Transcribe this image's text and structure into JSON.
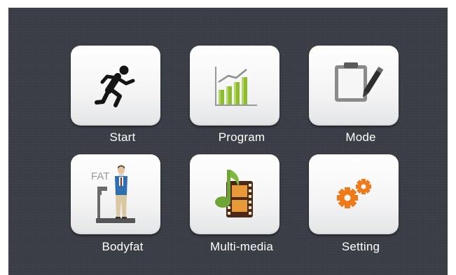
{
  "menu": {
    "items": [
      {
        "id": "start",
        "label": "Start",
        "icon": "running-person-icon"
      },
      {
        "id": "program",
        "label": "Program",
        "icon": "bar-chart-icon"
      },
      {
        "id": "mode",
        "label": "Mode",
        "icon": "clipboard-pen-icon"
      },
      {
        "id": "bodyfat",
        "label": "Bodyfat",
        "icon": "body-scale-icon",
        "icon_text": "FAT"
      },
      {
        "id": "multimedia",
        "label": "Multi-media",
        "icon": "music-film-icon"
      },
      {
        "id": "setting",
        "label": "Setting",
        "icon": "gears-icon"
      }
    ]
  },
  "colors": {
    "background": "#3c3f47",
    "tile": "#f5f5f6",
    "label": "#ffffff",
    "chart_green": "#8cb82e",
    "gear_orange": "#f07a18"
  }
}
